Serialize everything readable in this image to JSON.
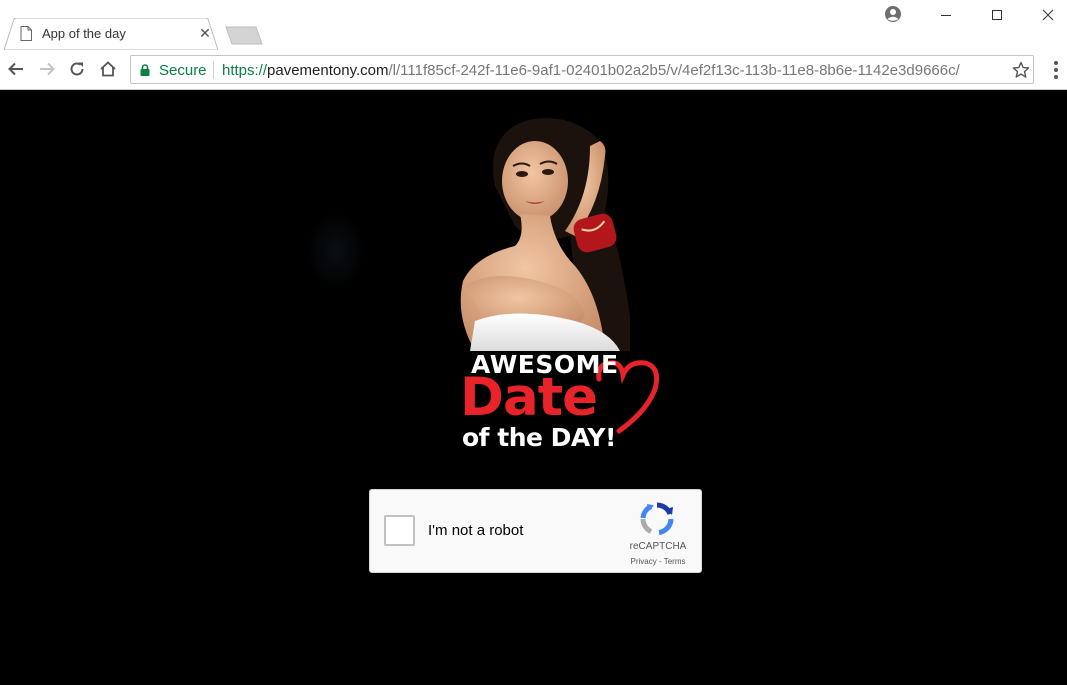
{
  "browser": {
    "tab": {
      "title": "App of the day",
      "page_icon": "page-icon",
      "close_label": "✕"
    },
    "window_controls": {
      "minimize": "—",
      "maximize": "☐",
      "close": "✕"
    },
    "omnibox": {
      "secure_label": "Secure",
      "url_scheme": "https://",
      "url_host": "pavementony.com",
      "url_path": "/l/111f85cf-242f-11e6-9af1-02401b02a2b5/v/4ef2f13c-113b-11e8-8b6e-1142e3d9666c/"
    },
    "colors": {
      "secure_green": "#0b8043",
      "toolbar_bg": "#ffffff"
    }
  },
  "page": {
    "logo": {
      "line1": "AWESOME",
      "line2": "Date",
      "line3": "of the DAY!"
    },
    "colors": {
      "background": "#000000",
      "logo_red": "#e8232a",
      "logo_white": "#ffffff"
    },
    "recaptcha": {
      "label": "I'm not a robot",
      "brand": "reCAPTCHA",
      "privacy": "Privacy",
      "separator": " - ",
      "terms": "Terms",
      "checked": false
    }
  }
}
